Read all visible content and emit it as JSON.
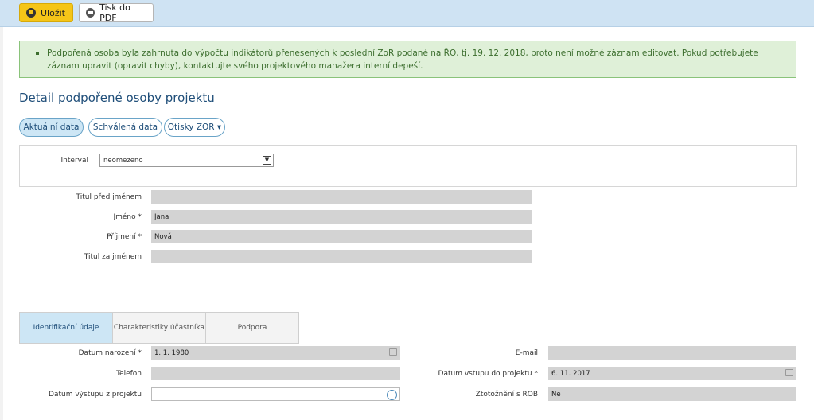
{
  "toolbar": {
    "save_label": "Uložit",
    "print_label": "Tisk do PDF"
  },
  "alert": {
    "text": "Podpořená osoba byla zahrnuta do výpočtu indikátorů přenesených k poslední ZoR podané na ŘO, tj. 19. 12. 2018, proto není možné záznam editovat. Pokud potřebujete záznam upravit (opravit chyby), kontaktujte svého projektového manažera interní depeší."
  },
  "page_title": "Detail podpořené osoby projektu",
  "view_tabs": {
    "current": "Aktuální data",
    "approved": "Schválená data",
    "zor": "Otisky ZOR ▾"
  },
  "interval": {
    "label": "Interval",
    "value": "neomezeno"
  },
  "person": {
    "title_before": {
      "label": "Titul před jménem",
      "value": ""
    },
    "first_name": {
      "label": "Jméno *",
      "value": "Jana"
    },
    "last_name": {
      "label": "Příjmení *",
      "value": "Nová"
    },
    "title_after": {
      "label": "Titul za jménem",
      "value": ""
    }
  },
  "section_tabs": {
    "ident": "Identifikační údaje",
    "char": "Charakteristiky účastníka",
    "support": "Podpora"
  },
  "ident": {
    "birth_date": {
      "label": "Datum narození *",
      "value": "1. 1. 1980"
    },
    "phone": {
      "label": "Telefon",
      "value": ""
    },
    "exit_date": {
      "label": "Datum výstupu z projektu",
      "value": ""
    },
    "email": {
      "label": "E-mail",
      "value": ""
    },
    "entry_date": {
      "label": "Datum vstupu do projektu *",
      "value": "6. 11. 2017"
    },
    "rob": {
      "label": "Ztotožnění s ROB",
      "value": "Ne"
    }
  }
}
